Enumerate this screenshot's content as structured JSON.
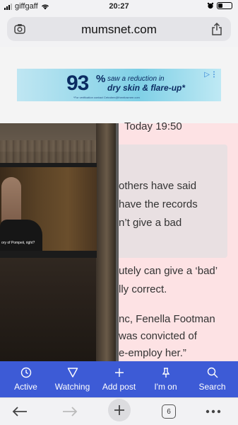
{
  "status_bar": {
    "carrier": "giffgaff",
    "time": "20:27"
  },
  "browser": {
    "url": "mumsnet.com",
    "tab_count": "6"
  },
  "ad": {
    "percent": "93",
    "percent_symbol": "%",
    "line1": "saw a reduction in",
    "line2": "dry skin & flare-up*",
    "fine_print": "*For verification contact Cetraben@thentiosmee.com"
  },
  "post": {
    "timestamp": "Today 19:50",
    "quote_lines": [
      "others have said",
      "have the records",
      "n’t give a bad"
    ],
    "body_lines": [
      "utely can give a ‘bad’",
      "lly correct.",
      "",
      "nc, Fenella Footman",
      "was convicted of",
      "e-employ her.”"
    ]
  },
  "video": {
    "caption": "ory of Pompeii, right?"
  },
  "bottom_nav": [
    {
      "label": "Active",
      "icon": "clock-icon"
    },
    {
      "label": "Watching",
      "icon": "filter-icon"
    },
    {
      "label": "Add post",
      "icon": "plus-icon"
    },
    {
      "label": "I'm on",
      "icon": "pin-icon"
    },
    {
      "label": "Search",
      "icon": "search-icon"
    }
  ],
  "colors": {
    "nav_bg": "#3d5bd6",
    "content_bg": "#fde2e4",
    "quote_bg": "#e9e0e2"
  }
}
